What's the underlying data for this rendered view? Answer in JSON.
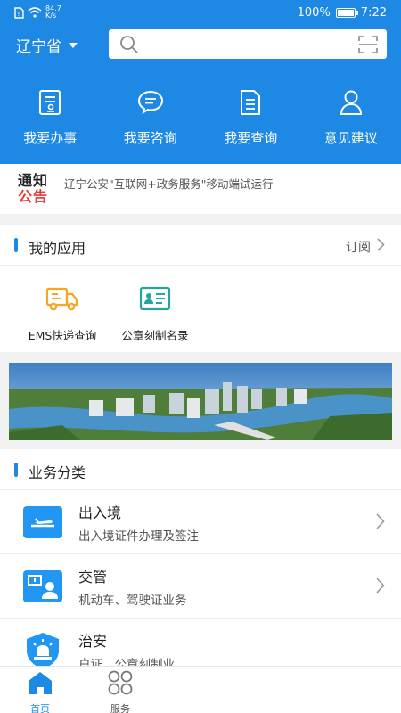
{
  "status_bar": {
    "net_speed_value": "84.7",
    "net_speed_unit": "K/s",
    "battery": "100%",
    "time": "7:22"
  },
  "header": {
    "province": "辽宁省",
    "search_placeholder": ""
  },
  "quick_actions": [
    {
      "label": "我要办事",
      "icon": "form-icon"
    },
    {
      "label": "我要咨询",
      "icon": "chat-bubble-icon"
    },
    {
      "label": "我要查询",
      "icon": "list-doc-icon"
    },
    {
      "label": "意见建议",
      "icon": "person-icon"
    }
  ],
  "notice": {
    "logo_top": "通知",
    "logo_bottom": "公告",
    "text": "辽宁公安\"互联网+政务服务\"移动端试运行"
  },
  "my_apps": {
    "title": "我的应用",
    "subscribe_label": "订阅",
    "items": [
      {
        "label": "EMS快递查询",
        "icon": "truck-icon",
        "color": "#f5a623"
      },
      {
        "label": "公章刻制名录",
        "icon": "id-card-icon",
        "color": "#26a69a"
      }
    ]
  },
  "categories": {
    "title": "业务分类",
    "items": [
      {
        "title": "出入境",
        "subtitle": "出入境证件办理及签注",
        "icon": "airplane-icon"
      },
      {
        "title": "交管",
        "subtitle": "机动车、驾驶证业务",
        "icon": "driver-license-icon"
      },
      {
        "title": "治安",
        "subtitle": "户证、公章刻制业",
        "icon": "police-light-icon"
      }
    ]
  },
  "tabbar": {
    "home_label": "首页",
    "service_label": "服务"
  },
  "colors": {
    "primary": "#1e88e5",
    "notice_red": "#e53935"
  }
}
